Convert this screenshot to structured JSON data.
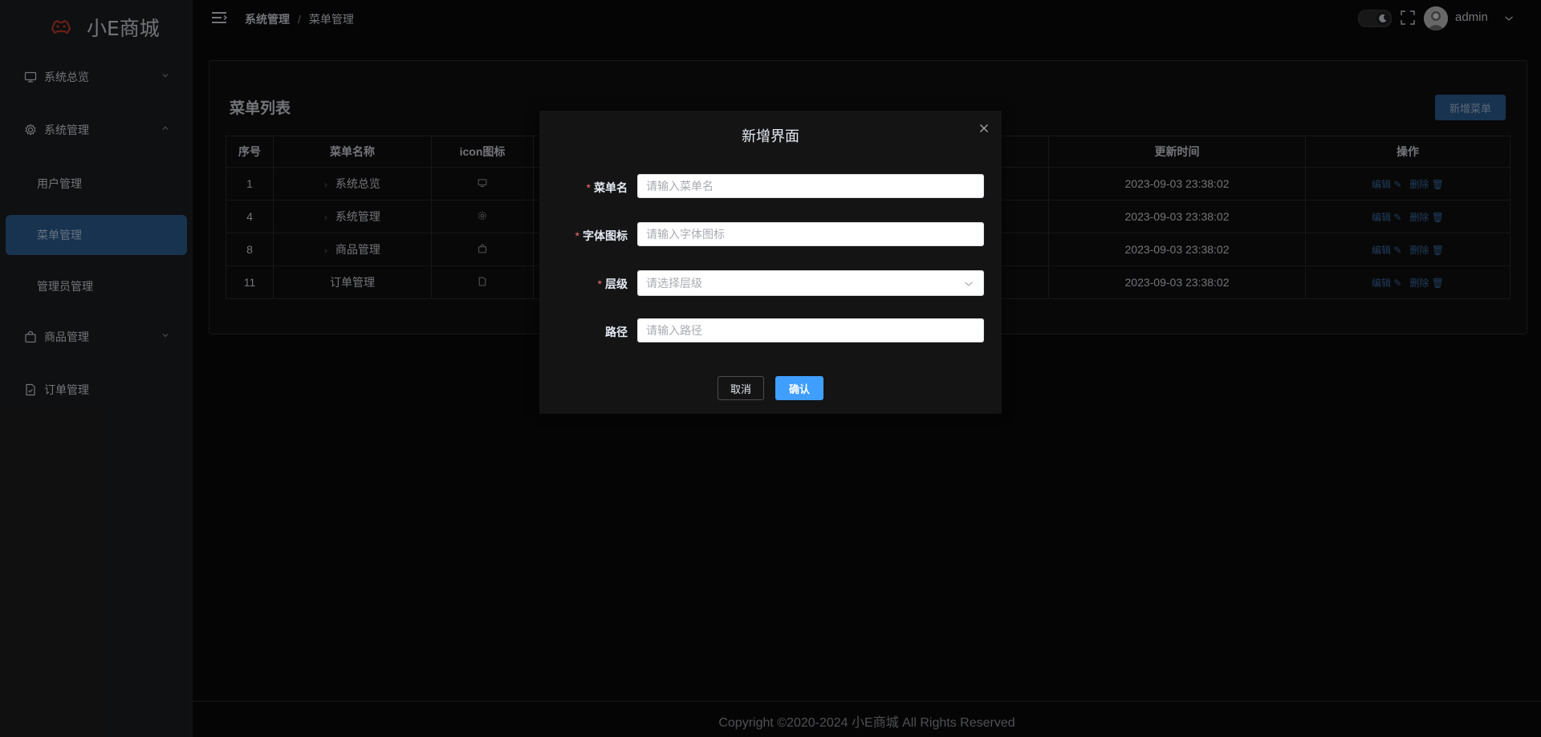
{
  "app": {
    "title": "小E商城",
    "accent_color": "#2c5d93",
    "logo_icon": "gamepad-logo-icon"
  },
  "sidebar": {
    "items": [
      {
        "label": "系统总览",
        "icon": "monitor-icon",
        "arrow": "chevron-down-icon"
      },
      {
        "label": "系统管理",
        "icon": "gear-icon",
        "arrow": "chevron-up-icon"
      },
      {
        "label": "用户管理"
      },
      {
        "label": "菜单管理",
        "active": true
      },
      {
        "label": "管理员管理"
      },
      {
        "label": "商品管理",
        "icon": "shopping-bag-icon",
        "arrow": "chevron-down-icon"
      },
      {
        "label": "订单管理",
        "icon": "document-check-icon"
      }
    ]
  },
  "header": {
    "breadcrumb": [
      "系统管理",
      "菜单管理"
    ],
    "separator": "/",
    "username": "admin"
  },
  "card": {
    "title": "菜单列表",
    "add_button": "新增菜单",
    "columns": [
      "序号",
      "菜单名称",
      "icon图标",
      "",
      "更新时间",
      "操作"
    ],
    "rows": [
      {
        "id": "1",
        "name": "系统总览",
        "icon": "monitor-icon",
        "expandable": true,
        "updated": "2023-09-03 23:38:02"
      },
      {
        "id": "4",
        "name": "系统管理",
        "icon": "gear-icon",
        "expandable": true,
        "updated": "2023-09-03 23:38:02"
      },
      {
        "id": "8",
        "name": "商品管理",
        "icon": "shopping-bag-icon",
        "expandable": true,
        "updated": "2023-09-03 23:38:02"
      },
      {
        "id": "11",
        "name": "订单管理",
        "icon": "document-icon",
        "expandable": false,
        "updated": "2023-09-03 23:38:02"
      }
    ],
    "edit_label": "编辑",
    "delete_label": "删除"
  },
  "dialog": {
    "title": "新增界面",
    "fields": [
      {
        "label": "菜单名",
        "required": true,
        "placeholder": "请输入菜单名"
      },
      {
        "label": "字体图标",
        "required": true,
        "placeholder": "请输入字体图标"
      },
      {
        "label": "层级",
        "required": true,
        "placeholder": "请选择层级"
      },
      {
        "label": "路径",
        "required": false,
        "placeholder": "请输入路径"
      }
    ],
    "cancel": "取消",
    "confirm": "确认"
  },
  "footer": {
    "copyright": "Copyright ©2020-2024 小E商城 All Rights Reserved"
  }
}
